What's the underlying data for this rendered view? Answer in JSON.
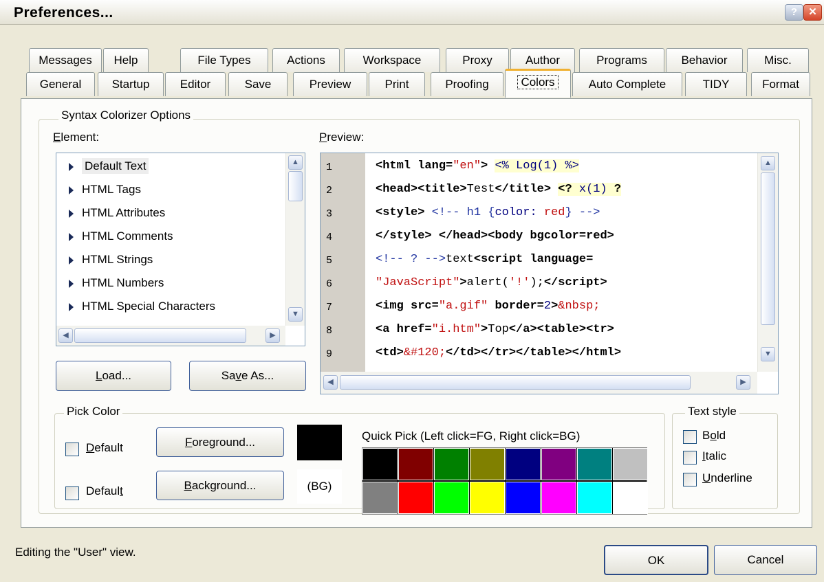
{
  "window": {
    "title": "Preferences...",
    "help_label": "?",
    "close_label": "✕"
  },
  "tabs_row1": [
    "Messages",
    "Help",
    "File Types",
    "Actions",
    "Workspace",
    "Proxy",
    "Author",
    "Programs",
    "Behavior",
    "Misc."
  ],
  "tabs_row2": [
    "General",
    "Startup",
    "Editor",
    "Save",
    "Preview",
    "Print",
    "Proofing",
    "Colors",
    "Auto Complete",
    "TIDY",
    "Format"
  ],
  "selected_tab": "Colors",
  "syntax_group": {
    "label": "Syntax Colorizer Options"
  },
  "element_list": {
    "label": "Element:",
    "items": [
      "Default Text",
      "HTML Tags",
      "HTML Attributes",
      "HTML Comments",
      "HTML Strings",
      "HTML Numbers",
      "HTML Special Characters"
    ],
    "selected": "Default Text"
  },
  "preview": {
    "label": "Preview:",
    "line_numbers": [
      "1",
      "2",
      "3",
      "4",
      "5",
      "6",
      "7",
      "8",
      "9"
    ]
  },
  "buttons": {
    "load": "Load...",
    "save_as": "Save As...",
    "foreground": "Foreground...",
    "background": "Background...",
    "ok": "OK",
    "cancel": "Cancel"
  },
  "pick_color": {
    "label": "Pick Color",
    "default_fg_label": "Default",
    "default_bg_label": "Default",
    "fg_color": "#000000",
    "bg_text": "(BG)"
  },
  "quick_pick": {
    "label": "Quick Pick (Left click=FG, Right click=BG)",
    "colors": [
      "#000000",
      "#800000",
      "#008000",
      "#808000",
      "#000080",
      "#800080",
      "#008080",
      "#c0c0c0",
      "#808080",
      "#ff0000",
      "#00ff00",
      "#ffff00",
      "#0000ff",
      "#ff00ff",
      "#00ffff",
      "#ffffff"
    ]
  },
  "text_style": {
    "label": "Text style",
    "bold": "Bold",
    "italic": "Italic",
    "underline": "Underline"
  },
  "status": "Editing the \"User\" view."
}
